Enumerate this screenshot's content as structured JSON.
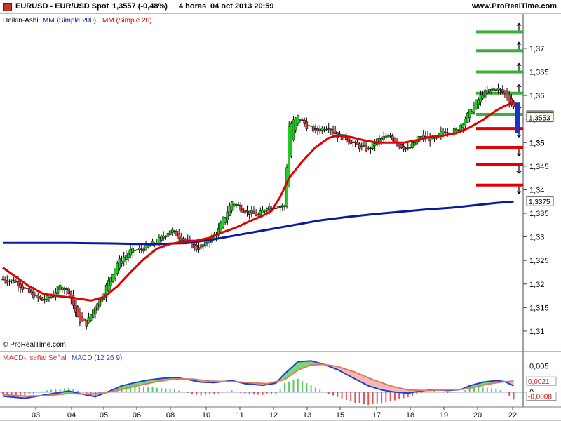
{
  "header": {
    "symbol": "EURUSD - EUR/USD Spot",
    "quote": "1,3557 (-0,48%)",
    "period": "4 horas",
    "datetime": "04 oct 2013 20:59",
    "site": "www.ProRealTime.com"
  },
  "price_panel": {
    "legend_prefix": "Heikin-Ashi",
    "legend_mm200": "MM (Simple 200)",
    "legend_mm20": "MM (Simple 20)",
    "copyright": "© ProRealTime.com",
    "y_ticks": [
      "1,37",
      "1,365",
      "1,36",
      "1,355",
      "1,35",
      "1,345",
      "1,34",
      "1,335",
      "1,33",
      "1,325",
      "1,32",
      "1,315",
      "1,31"
    ],
    "bold_ticks": [
      "1,35"
    ],
    "price_labels": [
      {
        "text": "1,3557",
        "value": 1.3557,
        "bg": "#f3d36b"
      },
      {
        "text": "1,3553",
        "value": 1.3553,
        "bg": "#ffffff"
      },
      {
        "text": "1,3375",
        "value": 1.3375,
        "bg": "#ffffff"
      }
    ],
    "levels": [
      {
        "value": 1.3735,
        "color": "#3aae3a"
      },
      {
        "value": 1.3695,
        "color": "#3aae3a"
      },
      {
        "value": 1.365,
        "color": "#3aae3a"
      },
      {
        "value": 1.3605,
        "color": "#3aae3a"
      },
      {
        "value": 1.356,
        "color": "#3aae3a"
      },
      {
        "value": 1.353,
        "color": "#e00000"
      },
      {
        "value": 1.349,
        "color": "#e00000"
      },
      {
        "value": 1.3453,
        "color": "#e00000"
      },
      {
        "value": 1.341,
        "color": "#e00000"
      }
    ]
  },
  "macd_panel": {
    "legend_macd_signal": "MACD-, señal Señal",
    "legend_macd": "MACD (12 26 9)",
    "y_ticks": [
      "0,005",
      "0"
    ],
    "value_labels": [
      {
        "text": "0,0021",
        "value": 0.0021
      },
      {
        "text": "-0,0008",
        "value": -0.0008
      }
    ]
  },
  "x_ticks": [
    "03",
    "04",
    "05",
    "06",
    "08",
    "10",
    "11",
    "12",
    "13",
    "15",
    "17",
    "18",
    "19",
    "20",
    "22"
  ],
  "colors": {
    "bull": "#22cc22",
    "bear": "#d04545",
    "sma20": "#e00000",
    "sma200": "#0a1aa0",
    "macd": "#1f3fd0",
    "signal": "#e07a5a",
    "hist_pos": "#55cc55",
    "hist_neg": "#dd5555"
  },
  "chart_data": [
    {
      "type": "candlestick",
      "title": "EURUSD - EUR/USD Spot",
      "style": "Heikin-Ashi",
      "ylim": [
        1.3085,
        1.3755
      ],
      "x_labels": [
        "03",
        "04",
        "05",
        "06",
        "08",
        "10",
        "11",
        "12",
        "13",
        "15",
        "17",
        "18",
        "19",
        "20",
        "22"
      ],
      "close_path": [
        [
          0,
          1.321
        ],
        [
          6,
          1.3205
        ],
        [
          12,
          1.318
        ],
        [
          18,
          1.3165
        ],
        [
          22,
          1.3175
        ],
        [
          26,
          1.3195
        ],
        [
          30,
          1.3185
        ],
        [
          34,
          1.3125
        ],
        [
          38,
          1.3115
        ],
        [
          42,
          1.3155
        ],
        [
          46,
          1.3185
        ],
        [
          52,
          1.3245
        ],
        [
          58,
          1.327
        ],
        [
          64,
          1.3275
        ],
        [
          70,
          1.329
        ],
        [
          76,
          1.3315
        ],
        [
          82,
          1.3295
        ],
        [
          88,
          1.3275
        ],
        [
          92,
          1.3285
        ],
        [
          98,
          1.3315
        ],
        [
          104,
          1.3375
        ],
        [
          110,
          1.3355
        ],
        [
          116,
          1.3345
        ],
        [
          120,
          1.3365
        ],
        [
          124,
          1.3365
        ],
        [
          128,
          1.3365
        ],
        [
          130,
          1.3535
        ],
        [
          134,
          1.3555
        ],
        [
          138,
          1.3535
        ],
        [
          142,
          1.3525
        ],
        [
          148,
          1.3535
        ],
        [
          152,
          1.3515
        ],
        [
          156,
          1.351
        ],
        [
          160,
          1.3495
        ],
        [
          166,
          1.3485
        ],
        [
          170,
          1.3505
        ],
        [
          176,
          1.3515
        ],
        [
          180,
          1.3495
        ],
        [
          184,
          1.3485
        ],
        [
          190,
          1.3515
        ],
        [
          196,
          1.3505
        ],
        [
          200,
          1.3525
        ],
        [
          206,
          1.3525
        ],
        [
          212,
          1.3565
        ],
        [
          218,
          1.3605
        ],
        [
          224,
          1.3615
        ],
        [
          228,
          1.3605
        ],
        [
          232,
          1.3575
        ]
      ],
      "series": [
        {
          "name": "MM (Simple 200)",
          "points": [
            [
              0,
              1.3287
            ],
            [
              30,
              1.3287
            ],
            [
              50,
              1.3286
            ],
            [
              60,
              1.3285
            ],
            [
              72,
              1.3285
            ],
            [
              84,
              1.3287
            ],
            [
              96,
              1.3295
            ],
            [
              108,
              1.3305
            ],
            [
              120,
              1.3315
            ],
            [
              132,
              1.3325
            ],
            [
              144,
              1.3335
            ],
            [
              156,
              1.3342
            ],
            [
              168,
              1.3348
            ],
            [
              180,
              1.3353
            ],
            [
              192,
              1.3358
            ],
            [
              204,
              1.3362
            ],
            [
              214,
              1.3367
            ],
            [
              224,
              1.3372
            ],
            [
              232,
              1.3375
            ]
          ]
        },
        {
          "name": "MM (Simple 20)",
          "points": [
            [
              0,
              1.3235
            ],
            [
              6,
              1.3215
            ],
            [
              12,
              1.3195
            ],
            [
              18,
              1.318
            ],
            [
              24,
              1.3175
            ],
            [
              30,
              1.3172
            ],
            [
              36,
              1.3168
            ],
            [
              40,
              1.3165
            ],
            [
              46,
              1.3172
            ],
            [
              52,
              1.3195
            ],
            [
              58,
              1.3225
            ],
            [
              64,
              1.3253
            ],
            [
              70,
              1.3275
            ],
            [
              76,
              1.3285
            ],
            [
              82,
              1.329
            ],
            [
              88,
              1.3292
            ],
            [
              94,
              1.3298
            ],
            [
              100,
              1.331
            ],
            [
              106,
              1.332
            ],
            [
              112,
              1.3333
            ],
            [
              118,
              1.3345
            ],
            [
              122,
              1.3355
            ],
            [
              126,
              1.3385
            ],
            [
              130,
              1.3425
            ],
            [
              136,
              1.346
            ],
            [
              142,
              1.349
            ],
            [
              148,
              1.351
            ],
            [
              152,
              1.3515
            ],
            [
              158,
              1.3512
            ],
            [
              164,
              1.3505
            ],
            [
              170,
              1.35
            ],
            [
              176,
              1.35
            ],
            [
              182,
              1.35
            ],
            [
              188,
              1.3505
            ],
            [
              194,
              1.3512
            ],
            [
              200,
              1.3515
            ],
            [
              206,
              1.352
            ],
            [
              212,
              1.3532
            ],
            [
              218,
              1.3548
            ],
            [
              224,
              1.3568
            ],
            [
              228,
              1.3578
            ],
            [
              232,
              1.3585
            ]
          ]
        }
      ]
    },
    {
      "type": "line",
      "title": "MACD (12 26 9)",
      "ylim": [
        -0.0026,
        0.0071
      ],
      "series": [
        {
          "name": "MACD",
          "points": [
            [
              0,
              -0.0008
            ],
            [
              10,
              -0.0012
            ],
            [
              20,
              -0.0005
            ],
            [
              30,
              0.0002
            ],
            [
              36,
              -0.0004
            ],
            [
              42,
              -0.0009
            ],
            [
              48,
              0.0001
            ],
            [
              54,
              0.0012
            ],
            [
              60,
              0.0018
            ],
            [
              66,
              0.0023
            ],
            [
              72,
              0.0026
            ],
            [
              78,
              0.0028
            ],
            [
              84,
              0.0024
            ],
            [
              90,
              0.0019
            ],
            [
              96,
              0.0018
            ],
            [
              104,
              0.0022
            ],
            [
              110,
              0.0016
            ],
            [
              118,
              0.0013
            ],
            [
              124,
              0.0017
            ],
            [
              128,
              0.0035
            ],
            [
              134,
              0.0058
            ],
            [
              140,
              0.006
            ],
            [
              146,
              0.0053
            ],
            [
              152,
              0.0043
            ],
            [
              160,
              0.0025
            ],
            [
              166,
              0.0012
            ],
            [
              172,
              0.0004
            ],
            [
              178,
              0.0
            ],
            [
              184,
              -0.0002
            ],
            [
              190,
              0.0002
            ],
            [
              196,
              0.0005
            ],
            [
              202,
              0.0003
            ],
            [
              208,
              0.0005
            ],
            [
              212,
              0.0012
            ],
            [
              218,
              0.0019
            ],
            [
              224,
              0.0022
            ],
            [
              228,
              0.002
            ],
            [
              232,
              0.0012
            ]
          ]
        },
        {
          "name": "Señal",
          "points": [
            [
              0,
              -0.0005
            ],
            [
              10,
              -0.0008
            ],
            [
              20,
              -0.0007
            ],
            [
              30,
              -0.0003
            ],
            [
              38,
              -0.0004
            ],
            [
              46,
              -0.0002
            ],
            [
              54,
              0.0005
            ],
            [
              62,
              0.0013
            ],
            [
              70,
              0.002
            ],
            [
              78,
              0.0025
            ],
            [
              86,
              0.0025
            ],
            [
              94,
              0.0021
            ],
            [
              104,
              0.002
            ],
            [
              112,
              0.0018
            ],
            [
              120,
              0.0016
            ],
            [
              128,
              0.0024
            ],
            [
              134,
              0.0042
            ],
            [
              140,
              0.0052
            ],
            [
              146,
              0.0053
            ],
            [
              152,
              0.0049
            ],
            [
              160,
              0.0038
            ],
            [
              168,
              0.0024
            ],
            [
              176,
              0.0012
            ],
            [
              184,
              0.0004
            ],
            [
              192,
              0.0003
            ],
            [
              200,
              0.0004
            ],
            [
              208,
              0.0005
            ],
            [
              214,
              0.0009
            ],
            [
              220,
              0.0015
            ],
            [
              226,
              0.0019
            ],
            [
              232,
              0.0021
            ]
          ]
        }
      ]
    }
  ]
}
